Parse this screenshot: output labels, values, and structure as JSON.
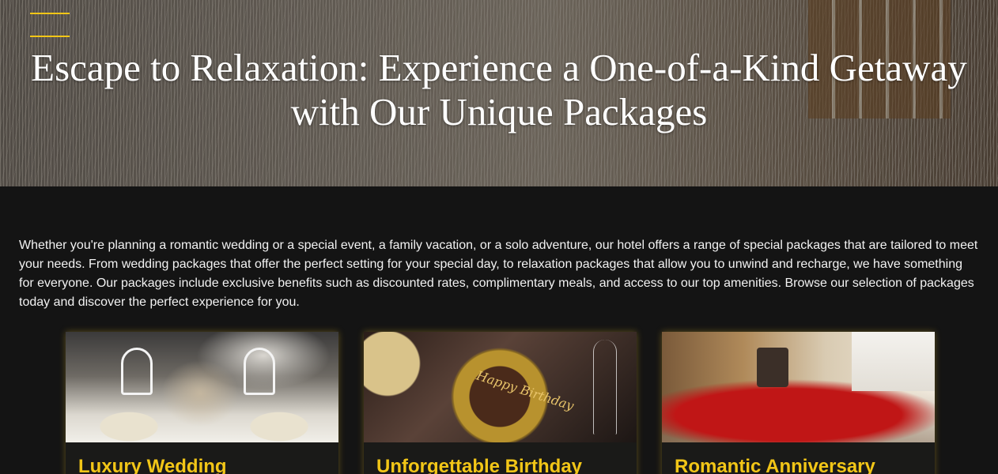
{
  "header": {
    "menu_icon": "hamburger-menu-icon",
    "accent_color": "#f2c617",
    "title": "Escape to Relaxation: Experience a One-of-a-Kind Getaway with Our Unique Packages"
  },
  "intro": {
    "text": "Whether you're planning a romantic wedding or a special event, a family vacation, or a solo adventure, our hotel offers a range of special packages that are tailored to meet your needs. From wedding packages that offer the perfect setting for your special day, to relaxation packages that allow you to unwind and recharge, we have something for everyone. Our packages include exclusive benefits such as discounted rates, complimentary meals, and access to our top amenities. Browse our selection of packages today and discover the perfect experience for you."
  },
  "packages": [
    {
      "title": "Luxury Wedding"
    },
    {
      "title": "Unforgettable Birthday"
    },
    {
      "title": "Romantic Anniversary"
    }
  ],
  "birthday_image_text": "Happy Birthday"
}
